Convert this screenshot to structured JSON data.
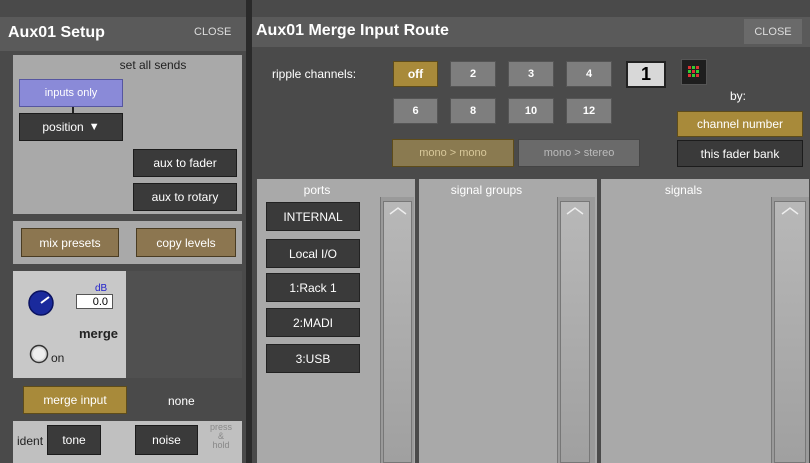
{
  "setup": {
    "title": "Aux01 Setup",
    "close_label": "CLOSE",
    "set_all_sends": "set all sends",
    "inputs_only": "inputs only",
    "position": "position",
    "aux_to_fader": "aux to fader",
    "aux_to_rotary": "aux to rotary",
    "mix_presets": "mix presets",
    "copy_levels": "copy levels",
    "db_label": "dB",
    "db_value": "0.0",
    "merge_label": "merge",
    "on_label": "on",
    "merge_input": "merge input",
    "merge_input_value": "none",
    "ident_label": "ident",
    "tone": "tone",
    "noise": "noise",
    "press_hold": [
      "press",
      "&",
      "hold"
    ]
  },
  "route": {
    "title": "Aux01 Merge Input Route",
    "close_label": "CLOSE",
    "ripple_label": "ripple channels:",
    "ripple_buttons": [
      "off",
      "2",
      "3",
      "4",
      "6",
      "8",
      "10",
      "12"
    ],
    "ripple_active": "off",
    "ripple_count": "1",
    "mono_mono": "mono > mono",
    "mono_stereo": "mono > stereo",
    "by_label": "by:",
    "channel_number": "channel number",
    "this_fader_bank": "this fader bank",
    "columns": {
      "ports": "ports",
      "signal_groups": "signal groups",
      "signals": "signals"
    },
    "ports": [
      "INTERNAL",
      "Local I/O",
      "1:Rack 1",
      "2:MADI",
      "3:USB"
    ]
  },
  "colors": {
    "accent_gold": "#a88a3a",
    "panel_gray": "#a9a9a9",
    "button_dark": "#3a3a3a",
    "knob_blue": "#1a2a9c"
  }
}
